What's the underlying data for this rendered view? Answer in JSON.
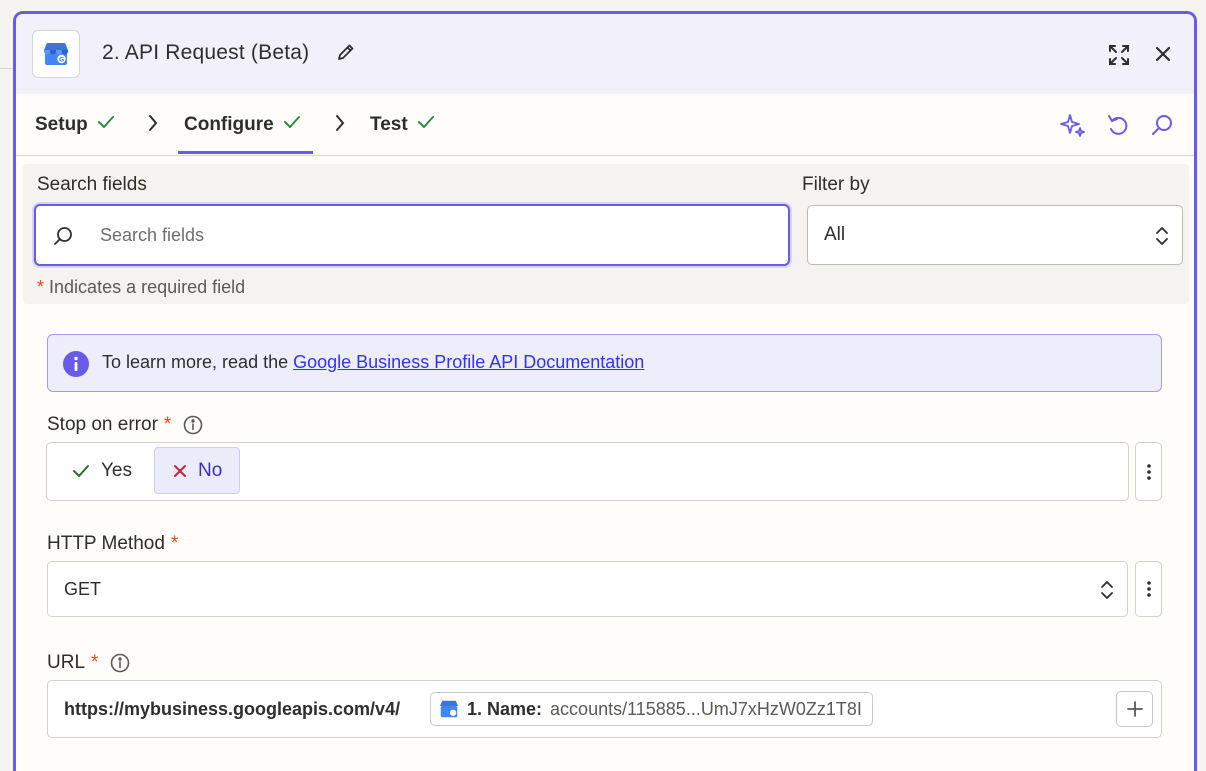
{
  "header": {
    "title": "2. API Request (Beta)"
  },
  "tabs": [
    {
      "label": "Setup",
      "done": true
    },
    {
      "label": "Configure",
      "done": true,
      "active": true
    },
    {
      "label": "Test",
      "done": true
    }
  ],
  "search": {
    "label": "Search fields",
    "placeholder": "Search fields",
    "value": ""
  },
  "filter": {
    "label": "Filter by",
    "value": "All"
  },
  "required_note": {
    "star": "*",
    "text": "Indicates a required field"
  },
  "info": {
    "text": "To learn more, read the ",
    "link": "Google Business Profile API Documentation"
  },
  "stop_on_error": {
    "label": "Stop on error",
    "star": "*",
    "yes": "Yes",
    "no": "No",
    "selected": "No"
  },
  "http_method": {
    "label": "HTTP Method",
    "star": "*",
    "value": "GET"
  },
  "url": {
    "label": "URL",
    "star": "*",
    "prefix": "https://mybusiness.googleapis.com/v4/",
    "pill_label": "1. Name:",
    "pill_value": "accounts/115885...UmJ7xHzW0Zz1T8I"
  },
  "colors": {
    "accent": "#695be8",
    "required": "#e04d1c",
    "check": "#2e8b3e",
    "link": "#3333ee"
  },
  "icons": [
    "google-business-icon",
    "pencil-icon",
    "expand-icon",
    "close-icon",
    "check-icon",
    "chevron-right-icon",
    "sparkle-icon",
    "undo-icon",
    "search-icon",
    "info-icon",
    "x-icon",
    "updown-icon",
    "kebab-icon",
    "plus-icon"
  ]
}
